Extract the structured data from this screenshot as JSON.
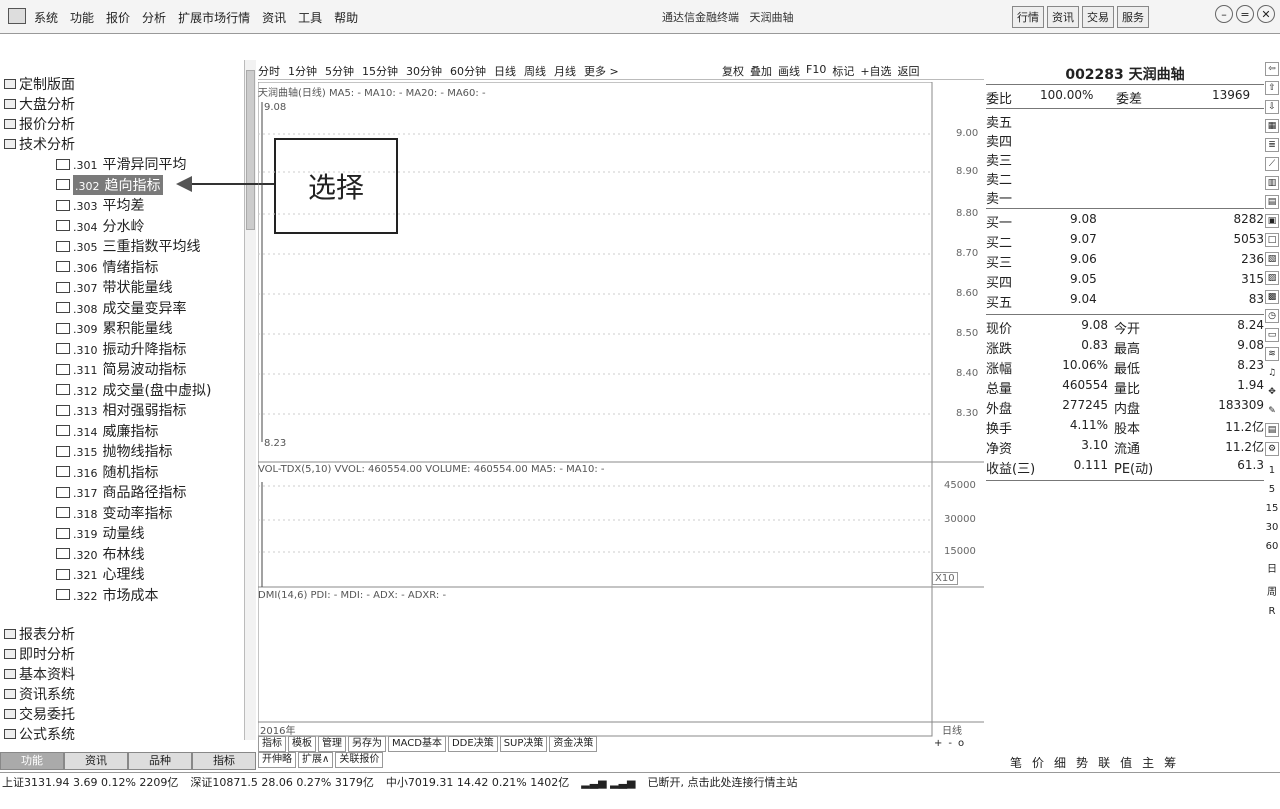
{
  "menubar": {
    "items": [
      "系统",
      "功能",
      "报价",
      "分析",
      "扩展市场行情",
      "资讯",
      "工具",
      "帮助"
    ],
    "app_title": "通达信金融终端",
    "stock_title": "天润曲轴",
    "right_buttons": [
      "行情",
      "资讯",
      "交易",
      "服务"
    ]
  },
  "tree": {
    "top_items": [
      "定制版面",
      "大盘分析",
      "报价分析",
      "技术分析"
    ],
    "tech_items": [
      {
        "code": ".301",
        "label": "平滑异同平均"
      },
      {
        "code": ".302",
        "label": "趋向指标"
      },
      {
        "code": ".303",
        "label": "平均差"
      },
      {
        "code": ".304",
        "label": "分水岭"
      },
      {
        "code": ".305",
        "label": "三重指数平均线"
      },
      {
        "code": ".306",
        "label": "情绪指标"
      },
      {
        "code": ".307",
        "label": "带状能量线"
      },
      {
        "code": ".308",
        "label": "成交量变异率"
      },
      {
        "code": ".309",
        "label": "累积能量线"
      },
      {
        "code": ".310",
        "label": "振动升降指标"
      },
      {
        "code": ".311",
        "label": "简易波动指标"
      },
      {
        "code": ".312",
        "label": "成交量(盘中虚拟)"
      },
      {
        "code": ".313",
        "label": "相对强弱指标"
      },
      {
        "code": ".314",
        "label": "威廉指标"
      },
      {
        "code": ".315",
        "label": "抛物线指标"
      },
      {
        "code": ".316",
        "label": "随机指标"
      },
      {
        "code": ".317",
        "label": "商品路径指标"
      },
      {
        "code": ".318",
        "label": "变动率指标"
      },
      {
        "code": ".319",
        "label": "动量线"
      },
      {
        "code": ".320",
        "label": "布林线"
      },
      {
        "code": ".321",
        "label": "心理线"
      },
      {
        "code": ".322",
        "label": "市场成本"
      }
    ],
    "bottom_items": [
      "报表分析",
      "即时分析",
      "基本资料",
      "资讯系统",
      "交易委托",
      "公式系统"
    ],
    "tabs": [
      "功能",
      "资讯",
      "品种",
      "指标"
    ]
  },
  "callout": {
    "text": "选择"
  },
  "chart_toolbar": {
    "periods": [
      "分时",
      "1分钟",
      "5分钟",
      "15分钟",
      "30分钟",
      "60分钟",
      "日线",
      "周线",
      "月线",
      "更多 >"
    ],
    "tools": [
      "复权",
      "叠加",
      "画线",
      "F10",
      "标记",
      "+自选",
      "返回"
    ]
  },
  "chart": {
    "header": "天润曲轴(日线) MA5: - MA10: - MA20: - MA60: -",
    "high_label": "9.08",
    "low_label": "8.23",
    "price_ticks": [
      "9.00",
      "8.90",
      "8.80",
      "8.70",
      "8.60",
      "8.50",
      "8.40",
      "8.30"
    ],
    "vol_header": "VOL-TDX(5,10) VVOL: 460554.00  VOLUME: 460554.00  MA5: - MA10: -",
    "vol_ticks": [
      "45000",
      "30000",
      "15000"
    ],
    "vol_unit": "X10",
    "dmi_header": "DMI(14,6) PDI: - MDI: - ADX: - ADXR: -",
    "year": "2016年",
    "period_label": "日线",
    "bottom_tabs": [
      "指标",
      "模板",
      "管理",
      "另存为",
      "MACD基本",
      "DDE决策",
      "SUP决策",
      "资金决策"
    ],
    "bottom_tabs2": [
      "开伸略",
      "扩展∧",
      "关联报价"
    ],
    "zoom_controls": [
      "+",
      "-",
      "o"
    ]
  },
  "quote": {
    "title": "002283 天润曲轴",
    "weibi_label": "委比",
    "weibi_value": "100.00%",
    "weicha_label": "委差",
    "weicha_value": "13969",
    "sell": [
      "卖五",
      "卖四",
      "卖三",
      "卖二",
      "卖一"
    ],
    "buy": [
      {
        "label": "买一",
        "price": "9.08",
        "vol": "8282"
      },
      {
        "label": "买二",
        "price": "9.07",
        "vol": "5053"
      },
      {
        "label": "买三",
        "price": "9.06",
        "vol": "236"
      },
      {
        "label": "买四",
        "price": "9.05",
        "vol": "315"
      },
      {
        "label": "买五",
        "price": "9.04",
        "vol": "83"
      }
    ],
    "stats": [
      {
        "l1": "现价",
        "v1": "9.08",
        "l2": "今开",
        "v2": "8.24"
      },
      {
        "l1": "涨跌",
        "v1": "0.83",
        "l2": "最高",
        "v2": "9.08"
      },
      {
        "l1": "涨幅",
        "v1": "10.06%",
        "l2": "最低",
        "v2": "8.23"
      },
      {
        "l1": "总量",
        "v1": "460554",
        "l2": "量比",
        "v2": "1.94"
      },
      {
        "l1": "外盘",
        "v1": "277245",
        "l2": "内盘",
        "v2": "183309"
      },
      {
        "l1": "换手",
        "v1": "4.11%",
        "l2": "股本",
        "v2": "11.2亿"
      },
      {
        "l1": "净资",
        "v1": "3.10",
        "l2": "流通",
        "v2": "11.2亿"
      },
      {
        "l1": "收益(三)",
        "v1": "0.111",
        "l2": "PE(动)",
        "v2": "61.3"
      }
    ],
    "bottom_tabs": [
      "笔",
      "价",
      "细",
      "势",
      "联",
      "值",
      "主",
      "筹"
    ]
  },
  "side_icons": [
    "1",
    "5",
    "15",
    "30",
    "60",
    "日",
    "周",
    "R"
  ],
  "status": [
    "上证3131.94  3.69  0.12%  2209亿",
    "深证10871.5  28.06  0.27%  3179亿",
    "中小7019.31  14.42  0.21%  1402亿",
    "已断开, 点击此处连接行情主站"
  ]
}
